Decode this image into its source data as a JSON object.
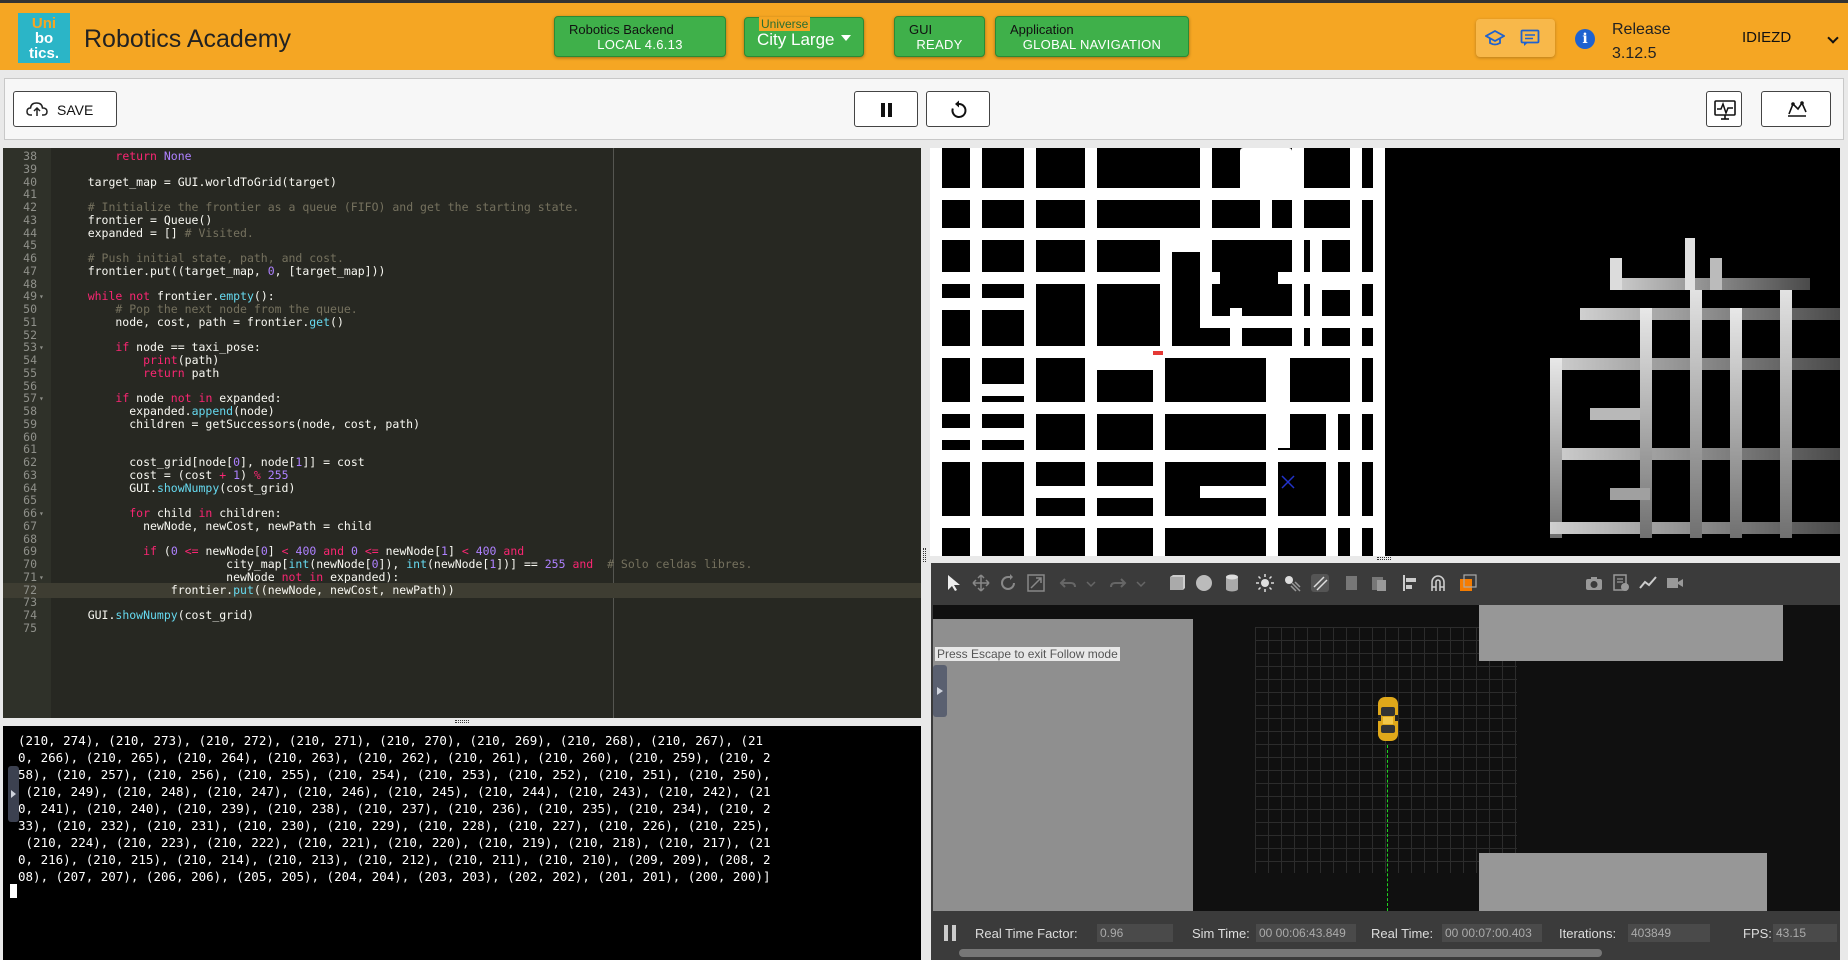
{
  "header": {
    "logo_lines": [
      "Uni",
      "bo",
      "tics."
    ],
    "app_title": "Robotics Academy",
    "backend": {
      "caption": "Robotics Backend",
      "value": "LOCAL 4.6.13"
    },
    "universe": {
      "caption": "Universe",
      "value": "City Large"
    },
    "gui": {
      "caption": "GUI",
      "value": "READY"
    },
    "application": {
      "caption": "Application",
      "value": "GLOBAL NAVIGATION"
    },
    "release_label": "Release",
    "release_version": "3.12.5",
    "user": "IDIEZD",
    "colors": {
      "bar": "#f5a623",
      "status_green": "#3fb04a",
      "logo": "#2bb5c7"
    }
  },
  "toolbar": {
    "save_label": "SAVE"
  },
  "editor": {
    "lines": [
      {
        "n": "38",
        "fold": false,
        "html": "        <span class=\"kw\">return</span> <span class=\"num\">None</span>"
      },
      {
        "n": "39",
        "fold": false,
        "html": ""
      },
      {
        "n": "40",
        "fold": false,
        "html": "    target_map = GUI.worldToGrid(target)"
      },
      {
        "n": "41",
        "fold": false,
        "html": ""
      },
      {
        "n": "42",
        "fold": false,
        "html": "    <span class=\"cm\"># Initialize the frontier as a queue (FIFO) and get the starting state.</span>"
      },
      {
        "n": "43",
        "fold": false,
        "html": "    frontier = Queue()"
      },
      {
        "n": "44",
        "fold": false,
        "html": "    expanded = [] <span class=\"cm\"># Visited.</span>"
      },
      {
        "n": "45",
        "fold": false,
        "html": ""
      },
      {
        "n": "46",
        "fold": false,
        "html": "    <span class=\"cm\"># Push initial state, path, and cost.</span>"
      },
      {
        "n": "47",
        "fold": false,
        "html": "    frontier.put((target_map, <span class=\"num\">0</span>, [target_map]))"
      },
      {
        "n": "48",
        "fold": false,
        "html": ""
      },
      {
        "n": "49",
        "fold": true,
        "html": "    <span class=\"kw\">while</span> <span class=\"kw\">not</span> frontier.<span class=\"fn\">empty</span>():"
      },
      {
        "n": "50",
        "fold": false,
        "html": "        <span class=\"cm\"># Pop the next node from the queue.</span>"
      },
      {
        "n": "51",
        "fold": false,
        "html": "        node, cost, path = frontier.<span class=\"fn\">get</span>()"
      },
      {
        "n": "52",
        "fold": false,
        "html": ""
      },
      {
        "n": "53",
        "fold": true,
        "html": "        <span class=\"kw\">if</span> node == taxi_pose:"
      },
      {
        "n": "54",
        "fold": false,
        "html": "            <span class=\"kw\">print</span>(path)"
      },
      {
        "n": "55",
        "fold": false,
        "html": "            <span class=\"kw\">return</span> path"
      },
      {
        "n": "56",
        "fold": false,
        "html": ""
      },
      {
        "n": "57",
        "fold": true,
        "html": "        <span class=\"kw\">if</span> node <span class=\"kw\">not</span> <span class=\"kw\">in</span> expanded:"
      },
      {
        "n": "58",
        "fold": false,
        "html": "          expanded.<span class=\"fn\">append</span>(node)"
      },
      {
        "n": "59",
        "fold": false,
        "html": "          children = getSuccessors(node, cost, path)"
      },
      {
        "n": "60",
        "fold": false,
        "html": ""
      },
      {
        "n": "61",
        "fold": false,
        "html": ""
      },
      {
        "n": "62",
        "fold": false,
        "html": "          cost_grid[node[<span class=\"num\">0</span>], node[<span class=\"num\">1</span>]] = cost"
      },
      {
        "n": "63",
        "fold": false,
        "html": "          cost = (cost <span class=\"kw\">+</span> <span class=\"num\">1</span>) <span class=\"kw\">%</span> <span class=\"num\">255</span>"
      },
      {
        "n": "64",
        "fold": false,
        "html": "          GUI.<span class=\"fn\">showNumpy</span>(cost_grid)"
      },
      {
        "n": "65",
        "fold": false,
        "html": ""
      },
      {
        "n": "66",
        "fold": true,
        "html": "          <span class=\"kw\">for</span> child <span class=\"kw\">in</span> children:"
      },
      {
        "n": "67",
        "fold": false,
        "html": "            newNode, newCost, newPath = child"
      },
      {
        "n": "68",
        "fold": false,
        "html": ""
      },
      {
        "n": "69",
        "fold": false,
        "html": "            <span class=\"kw\">if</span> (<span class=\"num\">0</span> <span class=\"kw\">&lt;=</span> newNode[<span class=\"num\">0</span>] <span class=\"kw\">&lt;</span> <span class=\"num\">400</span> <span class=\"kw\">and</span> <span class=\"num\">0</span> <span class=\"kw\">&lt;=</span> newNode[<span class=\"num\">1</span>] <span class=\"kw\">&lt;</span> <span class=\"num\">400</span> <span class=\"kw\">and</span>"
      },
      {
        "n": "70",
        "fold": false,
        "html": "                        city_map[<span class=\"fn\">int</span>(newNode[<span class=\"num\">0</span>]), <span class=\"fn\">int</span>(newNode[<span class=\"num\">1</span>])] == <span class=\"num\">255</span> <span class=\"kw\">and</span>  <span class=\"cm\"># Solo celdas libres.</span>"
      },
      {
        "n": "71",
        "fold": true,
        "html": "                        newNode <span class=\"kw\">not</span> <span class=\"kw\">in</span> expanded):"
      },
      {
        "n": "72",
        "fold": false,
        "active": true,
        "html": "                frontier.<span class=\"fn\">put</span>((newNode, newCost, newPath))"
      },
      {
        "n": "73",
        "fold": false,
        "html": ""
      },
      {
        "n": "74",
        "fold": false,
        "html": "    GUI.<span class=\"fn\">showNumpy</span>(cost_grid)"
      },
      {
        "n": "75",
        "fold": false,
        "html": ""
      }
    ],
    "plus_label": "+",
    "minus_label": "−"
  },
  "console": {
    "output_lines": [
      "(210, 274), (210, 273), (210, 272), (210, 271), (210, 270), (210, 269), (210, 268), (210, 267), (21",
      "0, 266), (210, 265), (210, 264), (210, 263), (210, 262), (210, 261), (210, 260), (210, 259), (210, 2",
      "58), (210, 257), (210, 256), (210, 255), (210, 254), (210, 253), (210, 252), (210, 251), (210, 250),",
      " (210, 249), (210, 248), (210, 247), (210, 246), (210, 245), (210, 244), (210, 243), (210, 242), (21",
      "0, 241), (210, 240), (210, 239), (210, 238), (210, 237), (210, 236), (210, 235), (210, 234), (210, 2",
      "33), (210, 232), (210, 231), (210, 230), (210, 229), (210, 228), (210, 227), (210, 226), (210, 225),",
      " (210, 224), (210, 223), (210, 222), (210, 221), (210, 220), (210, 219), (210, 218), (210, 217), (21",
      "0, 216), (210, 215), (210, 214), (210, 213), (210, 212), (210, 211), (210, 210), (209, 209), (208, 2",
      "08), (207, 207), (206, 206), (205, 205), (204, 204), (203, 203), (202, 202), (201, 201), (200, 200)]"
    ]
  },
  "gazebo": {
    "hint": "Press Escape to exit Follow mode",
    "real_time_factor_label": "Real Time Factor:",
    "real_time_factor": "0.96",
    "sim_time_label": "Sim Time:",
    "sim_time": "00 00:06:43.849",
    "real_time_label": "Real Time:",
    "real_time": "00 00:07:00.403",
    "iterations_label": "Iterations:",
    "iterations": "403849",
    "fps_label": "FPS:",
    "fps": "43.15"
  }
}
